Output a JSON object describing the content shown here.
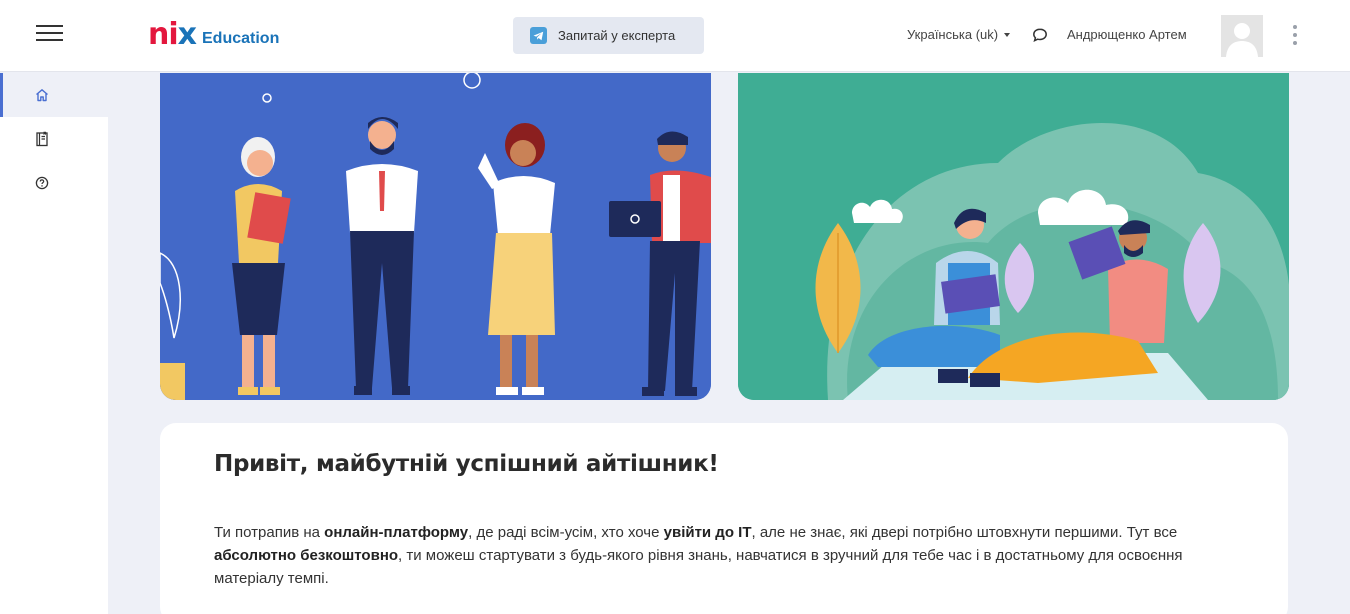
{
  "header": {
    "logo_brand": "nix",
    "logo_product": "Education",
    "expert_button_label": "Запитай у експерта",
    "language": "Українська (uk)",
    "user_name": "Андрющенко Артем"
  },
  "sidebar": {
    "items": [
      {
        "name": "home",
        "icon": "home-icon",
        "active": true
      },
      {
        "name": "courses",
        "icon": "book-icon",
        "active": false
      },
      {
        "name": "help",
        "icon": "question-icon",
        "active": false
      }
    ]
  },
  "welcome": {
    "title": "Привіт, майбутній успішний айтішник!",
    "p1": "Ти потрапив на ",
    "b1": "онлайн-платформу",
    "p2": ", де раді всім-усім, хто хоче ",
    "b2": "увійти до IT",
    "p3": ", але не знає, які двері потрібно штовхнути першими. Тут все ",
    "b3": "абсолютно безкоштовно",
    "p4": ", ти можеш стартувати з будь-якого рівня знань, навчатися в зручний для тебе час і в достатньому для освоєння матеріалу темпі."
  },
  "colors": {
    "brand_red": "#e3173e",
    "brand_blue": "#1a73b8",
    "banner_blue": "#4369c8",
    "banner_green": "#3fad94",
    "accent": "#4a6fd1"
  }
}
